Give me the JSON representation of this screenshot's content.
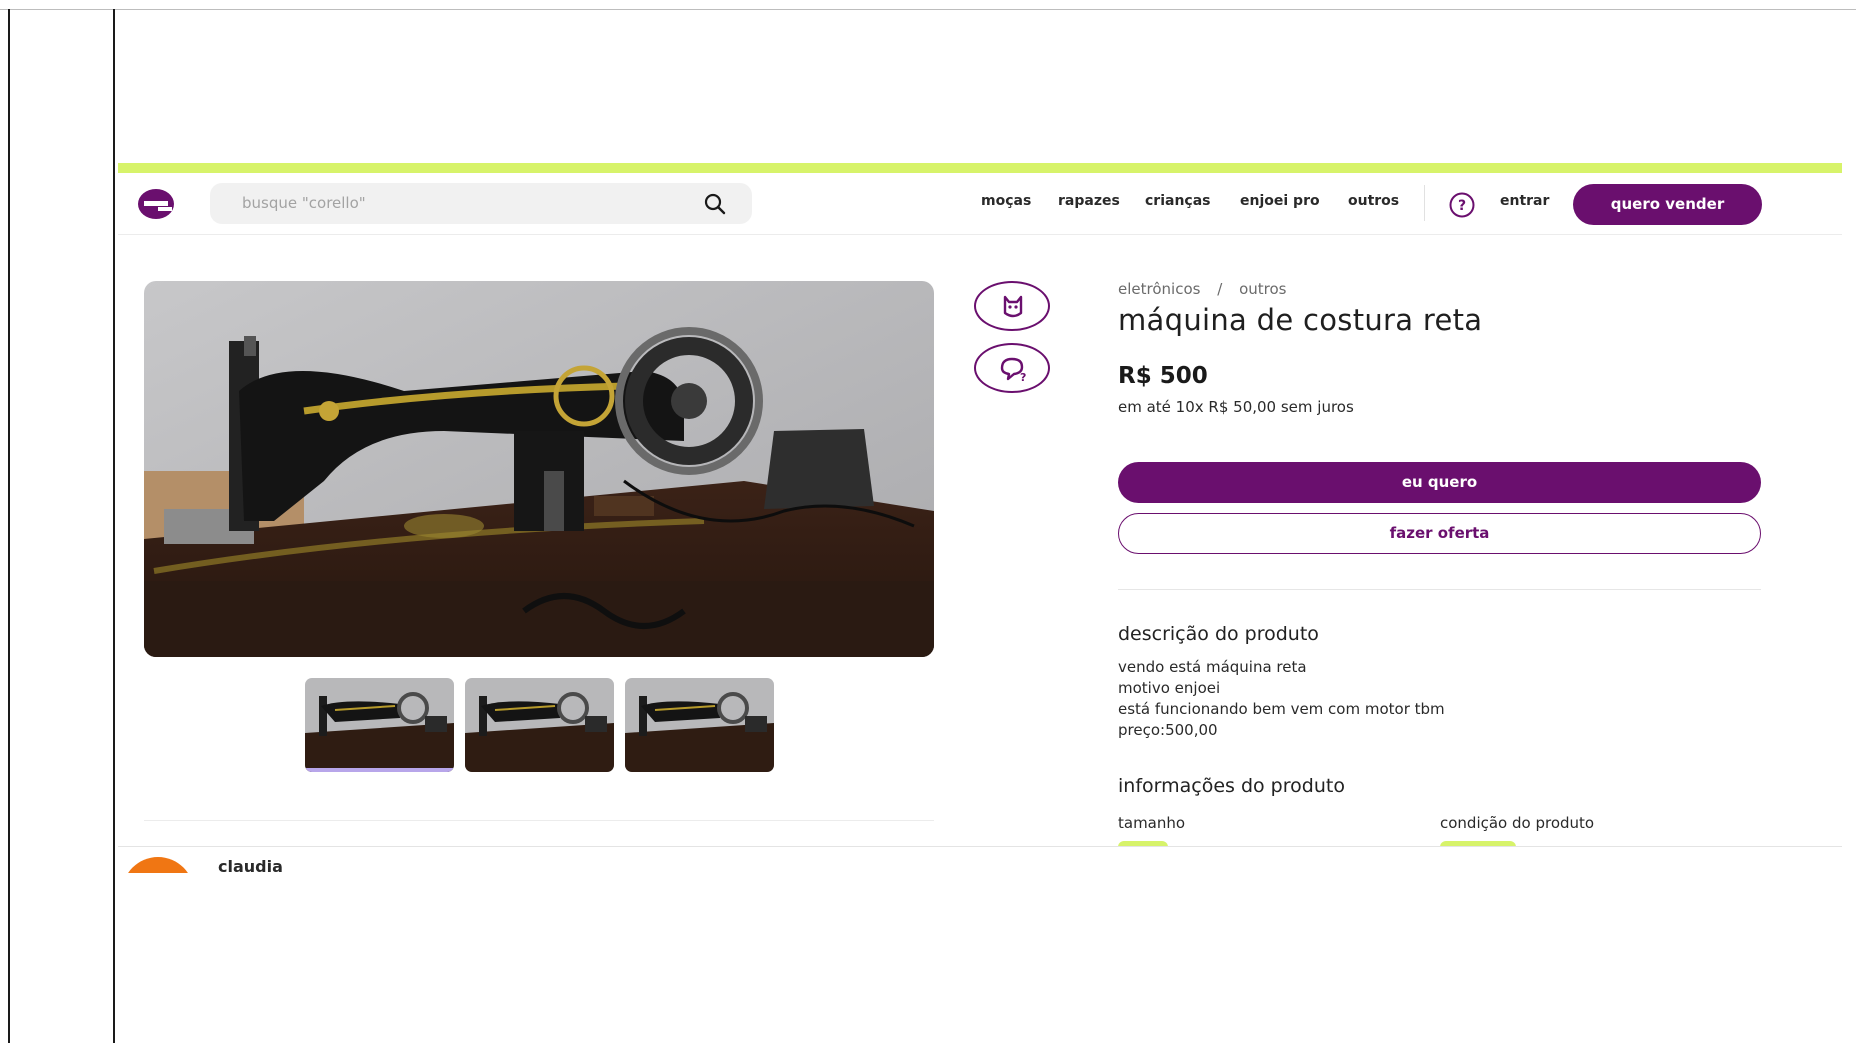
{
  "header": {
    "logo_letter": "e",
    "search_placeholder": "busque \"corello\"",
    "nav": [
      "moças",
      "rapazes",
      "crianças",
      "enjoei pro",
      "outros"
    ],
    "login_label": "entrar",
    "sell_label": "quero vender"
  },
  "gallery": {
    "thumbnail_count": 3,
    "active_thumbnail": 0
  },
  "product": {
    "breadcrumb": [
      "eletrônicos",
      "/",
      "outros"
    ],
    "title": "máquina de costura reta",
    "price": "R$ 500",
    "installments": "em até 10x R$ 50,00 sem juros",
    "buy_label": "eu quero",
    "offer_label": "fazer oferta"
  },
  "description": {
    "title": "descrição do produto",
    "lines": [
      "vendo está máquina reta",
      "motivo enjoei",
      "está funcionando bem vem com motor tbm",
      "preço:500,00"
    ]
  },
  "info": {
    "title": "informações do produto",
    "size_label": "tamanho",
    "condition_label": "condição do produto"
  },
  "seller": {
    "name": "claudia"
  },
  "colors": {
    "brand": "#6a0f6e",
    "accent": "#d7f36a",
    "avatar": "#f07613"
  },
  "icons": [
    "search-icon",
    "help-icon",
    "like-icon",
    "question-icon",
    "logo-icon"
  ]
}
